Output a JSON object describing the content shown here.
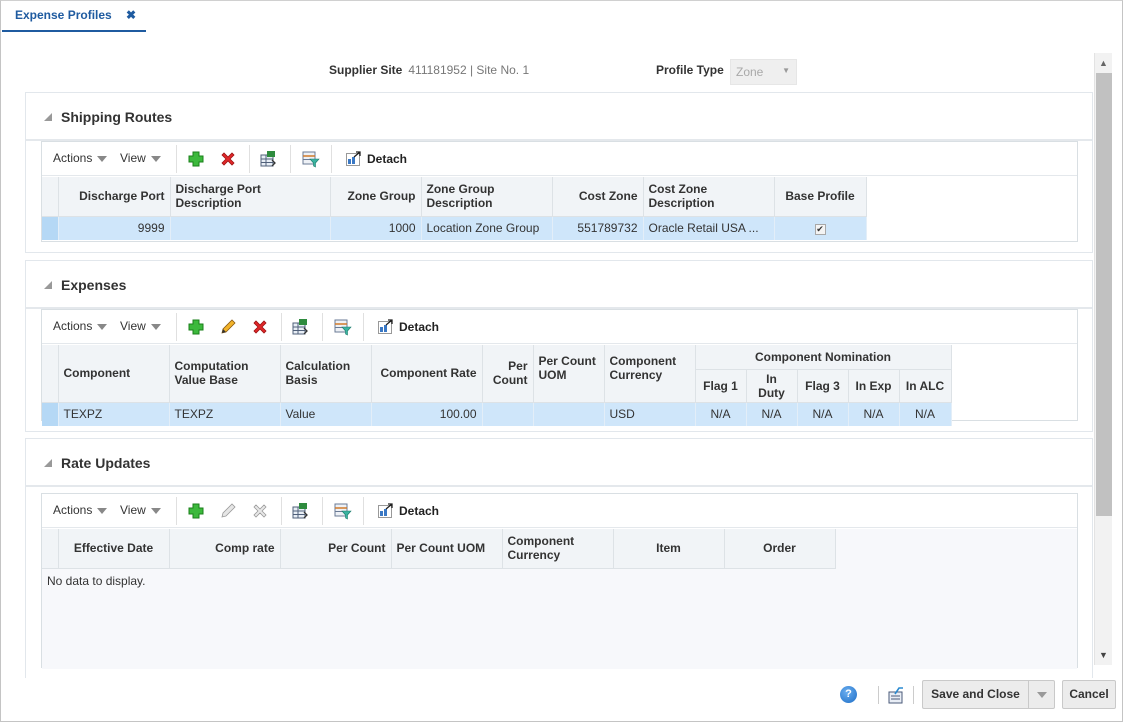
{
  "tab": {
    "label": "Expense Profiles",
    "close_glyph": "✖"
  },
  "header": {
    "supplier_site_label": "Supplier Site",
    "supplier_site_value": "411181952 | Site No. 1",
    "profile_type_label": "Profile Type",
    "profile_type_value": "Zone"
  },
  "toolbar_common": {
    "actions_label": "Actions",
    "view_label": "View",
    "detach_label": "Detach"
  },
  "shipping_routes": {
    "title": "Shipping Routes",
    "columns": [
      "Discharge Port",
      "Discharge Port Description",
      "Zone Group",
      "Zone Group Description",
      "Cost Zone",
      "Cost Zone Description",
      "Base Profile"
    ],
    "rows": [
      {
        "discharge_port": "9999",
        "discharge_port_description": "",
        "zone_group": "1000",
        "zone_group_description": "Location Zone Group",
        "cost_zone": "551789732",
        "cost_zone_description": "Oracle Retail USA ...",
        "base_profile": "✔"
      }
    ]
  },
  "expenses": {
    "title": "Expenses",
    "columns": [
      "Component",
      "Computation Value Base",
      "Calculation Basis",
      "Component Rate",
      "Per Count",
      "Per Count UOM",
      "Component Currency"
    ],
    "group_header": "Component Nomination",
    "group_columns": [
      "Flag 1",
      "In Duty",
      "Flag 3",
      "In Exp",
      "In ALC"
    ],
    "rows": [
      {
        "component": "TEXPZ",
        "computation_value_base": "TEXPZ",
        "calculation_basis": "Value",
        "component_rate": "100.00",
        "per_count": "",
        "per_count_uom": "",
        "component_currency": "USD",
        "flag1": "N/A",
        "in_duty": "N/A",
        "flag3": "N/A",
        "in_exp": "N/A",
        "in_alc": "N/A"
      }
    ]
  },
  "rate_updates": {
    "title": "Rate Updates",
    "columns": [
      "Effective Date",
      "Comp rate",
      "Per Count",
      "Per Count UOM",
      "Component Currency",
      "Item",
      "Order"
    ],
    "empty_message": "No data to display."
  },
  "footer": {
    "help_glyph": "?",
    "save_close_label": "Save and Close",
    "cancel_label": "Cancel"
  },
  "scroll": {
    "position_fraction": 0,
    "visible_fraction": 0.76
  },
  "colors": {
    "accent": "#1f5ba0",
    "row_selected": "#cfe6fa",
    "header_bg": "#f1f4f7"
  }
}
